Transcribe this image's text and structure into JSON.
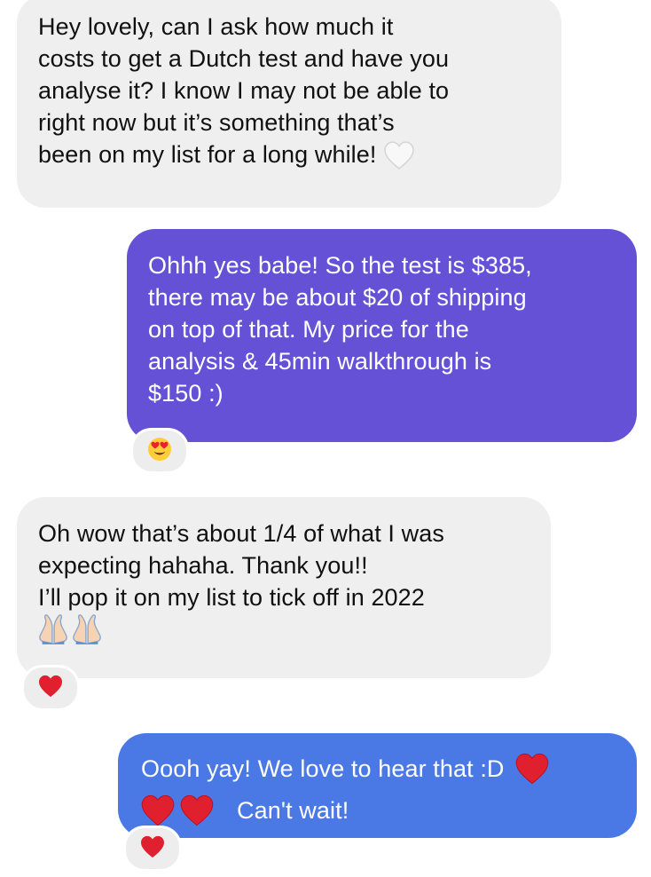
{
  "conversation": {
    "messages": [
      {
        "direction": "incoming",
        "lines": [
          "Hey lovely, can I ask how much it",
          "costs to get a Dutch test and have you",
          "analyse it? I know I may not be able to",
          "right now but it’s something that’s",
          "been on my list for a long while!"
        ],
        "trailing_emoji": "white-heart-icon",
        "reaction": null
      },
      {
        "direction": "outgoing",
        "bubble_color": "#6451d6",
        "lines": [
          "Ohhh yes babe! So the test is $385,",
          "there may be about $20 of shipping",
          "on top of that. My price for the",
          "analysis & 45min walkthrough is",
          "$150 :)"
        ],
        "reaction": "heart-eyes-emoji"
      },
      {
        "direction": "incoming",
        "lines": [
          "Oh wow that’s about 1/4 of what I was",
          "expecting hahaha. Thank you!!",
          "I’ll pop it on my list to tick off in 2022"
        ],
        "trailing_emoji": "praying-hands-icon x2",
        "reaction": "red-heart-emoji"
      },
      {
        "direction": "outgoing",
        "bubble_color": "#4a79e6",
        "lines": [
          "Oooh yay! We love to hear that :D",
          "Can't wait!"
        ],
        "inline_emoji": "red-heart-icon x3",
        "reaction": "red-heart-emoji"
      }
    ]
  },
  "colors": {
    "incoming_bubble": "#efefef",
    "incoming_text": "#101010",
    "outgoing_text": "#ffffff",
    "reaction_bg": "#ededed",
    "heart_red": "#e0202f"
  }
}
